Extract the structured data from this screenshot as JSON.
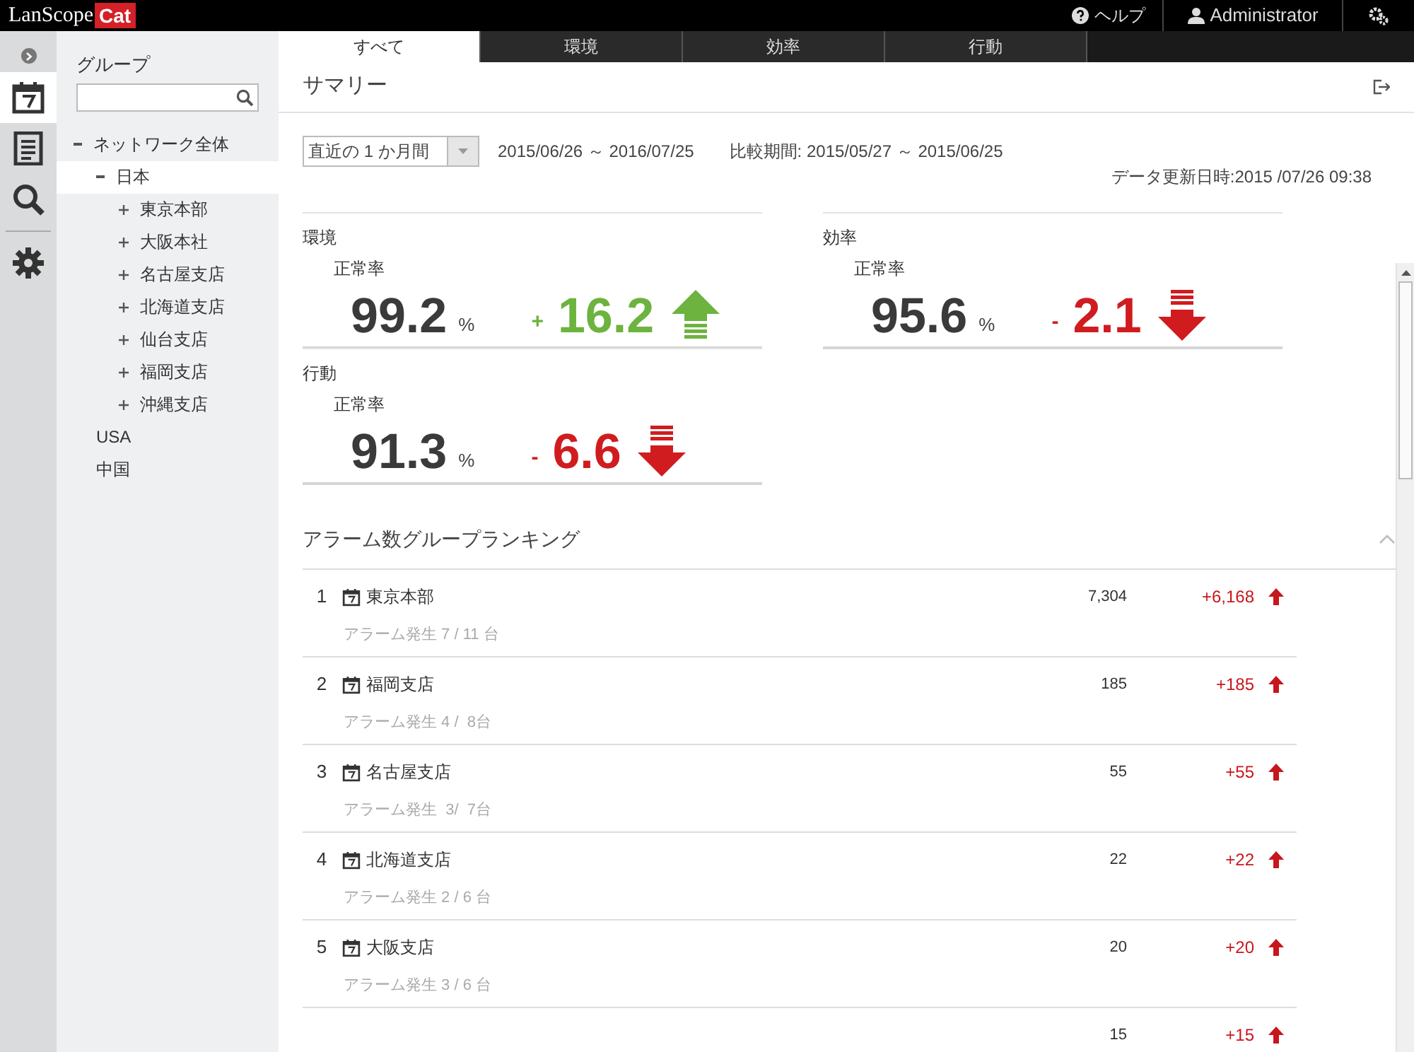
{
  "header": {
    "logo_left": "LanScope",
    "logo_right": "Cat",
    "help": "ヘルプ",
    "user": "Administrator"
  },
  "group_panel": {
    "title": "グループ",
    "tree": [
      {
        "label": "ネットワーク全体",
        "expanded": true,
        "selected": false,
        "children": [
          {
            "label": "日本",
            "expanded": true,
            "selected": true,
            "children": [
              {
                "label": "東京本部",
                "expanded": false,
                "selected": false
              },
              {
                "label": "大阪本社",
                "expanded": false,
                "selected": false
              },
              {
                "label": "名古屋支店",
                "expanded": false,
                "selected": false
              },
              {
                "label": "北海道支店",
                "expanded": false,
                "selected": false
              },
              {
                "label": "仙台支店",
                "expanded": false,
                "selected": false
              },
              {
                "label": "福岡支店",
                "expanded": false,
                "selected": false
              },
              {
                "label": "沖縄支店",
                "expanded": false,
                "selected": false
              }
            ]
          },
          {
            "label": "USA",
            "selected": false
          },
          {
            "label": "中国",
            "selected": false
          }
        ]
      }
    ]
  },
  "rail": [
    {
      "selected": true
    },
    {
      "selected": false
    },
    {
      "selected": false
    },
    {
      "selected": false
    }
  ],
  "tabs": [
    {
      "label": "すべて",
      "selected": true
    },
    {
      "label": "環境",
      "selected": false
    },
    {
      "label": "効率",
      "selected": false
    },
    {
      "label": "行動",
      "selected": false
    }
  ],
  "summary": {
    "title": "サマリー",
    "period_select": "直近の 1 か月間",
    "period": "2015/06/26 ～ 2016/07/25",
    "compare": "比較期間: 2015/05/27 ～ 2015/06/25",
    "updated": "データ更新日時:2015 /07/26 09:38"
  },
  "metrics": [
    {
      "category": "環境",
      "label": "正常率",
      "value": "99.2",
      "unit": "%",
      "sign": "+",
      "delta": "16.2",
      "kind": "rise",
      "color": "#6db33f"
    },
    {
      "category": "効率",
      "label": "正常率",
      "value": "95.6",
      "unit": "%",
      "sign": "-",
      "delta": "2.1",
      "kind": "fall",
      "color": "#d01c1f"
    },
    {
      "category": "行動",
      "label": "正常率",
      "value": "91.3",
      "unit": "%",
      "sign": "-",
      "delta": "6.6",
      "kind": "fall",
      "color": "#d01c1f"
    }
  ],
  "ranking": {
    "title": "アラーム数グループランキング",
    "rows": [
      {
        "rank": "1",
        "name": "東京本部",
        "sub": "アラーム発生 7 / 11 台",
        "count": "7,304",
        "delta": "+6,168"
      },
      {
        "rank": "2",
        "name": "福岡支店",
        "sub": "アラーム発生 4 /  8台",
        "count": "185",
        "delta": "+185"
      },
      {
        "rank": "3",
        "name": "名古屋支店",
        "sub": "アラーム発生  3/  7台",
        "count": "55",
        "delta": "+55"
      },
      {
        "rank": "4",
        "name": "北海道支店",
        "sub": "アラーム発生 2 / 6 台",
        "count": "22",
        "delta": "+22"
      },
      {
        "rank": "5",
        "name": "大阪支店",
        "sub": "アラーム発生 3 / 6 台",
        "count": "20",
        "delta": "+20"
      },
      {
        "count": "15",
        "delta": "+15"
      }
    ]
  }
}
